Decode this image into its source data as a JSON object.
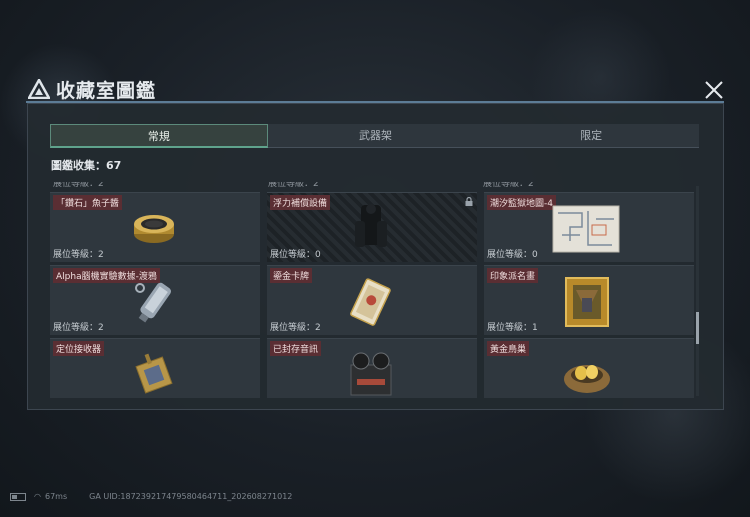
{
  "header": {
    "title": "收藏室圖鑑"
  },
  "tabs": [
    {
      "label": "常規",
      "active": true
    },
    {
      "label": "武器架",
      "active": false
    },
    {
      "label": "限定",
      "active": false
    }
  ],
  "collection": {
    "label": "圖鑑收集：",
    "value": "67"
  },
  "grid": {
    "level_prefix": "展位等級：",
    "items": [
      {
        "name": "「鑽石」魚子醬",
        "level": "2",
        "locked": false,
        "icon": "caviar-tin-icon"
      },
      {
        "name": "浮力補償設備",
        "level": "0",
        "locked": true,
        "icon": "diving-gear-icon"
      },
      {
        "name": "潮汐監獄地圖-4",
        "level": "0",
        "locked": false,
        "icon": "prison-map-icon"
      },
      {
        "name": "Alpha腦機實驗數據-渡鴉",
        "level": "2",
        "locked": false,
        "icon": "usb-drive-icon"
      },
      {
        "name": "鎏金卡牌",
        "level": "2",
        "locked": false,
        "icon": "gilded-card-icon"
      },
      {
        "name": "印象派名畫",
        "level": "1",
        "locked": false,
        "icon": "framed-painting-icon"
      },
      {
        "name": "定位接收器",
        "level": "",
        "locked": false,
        "icon": "locator-receiver-icon"
      },
      {
        "name": "已封存音訊",
        "level": "",
        "locked": false,
        "icon": "reel-recorder-icon"
      },
      {
        "name": "黃金鳥巢",
        "level": "",
        "locked": false,
        "icon": "golden-nest-icon"
      }
    ]
  },
  "footer": {
    "ping": "67ms",
    "uid": "GA UID:18723921747958046471​1_202608271012"
  },
  "colors": {
    "accent": "#5fa38c",
    "name_tag": "#5a2e33",
    "panel": "#232a30"
  }
}
